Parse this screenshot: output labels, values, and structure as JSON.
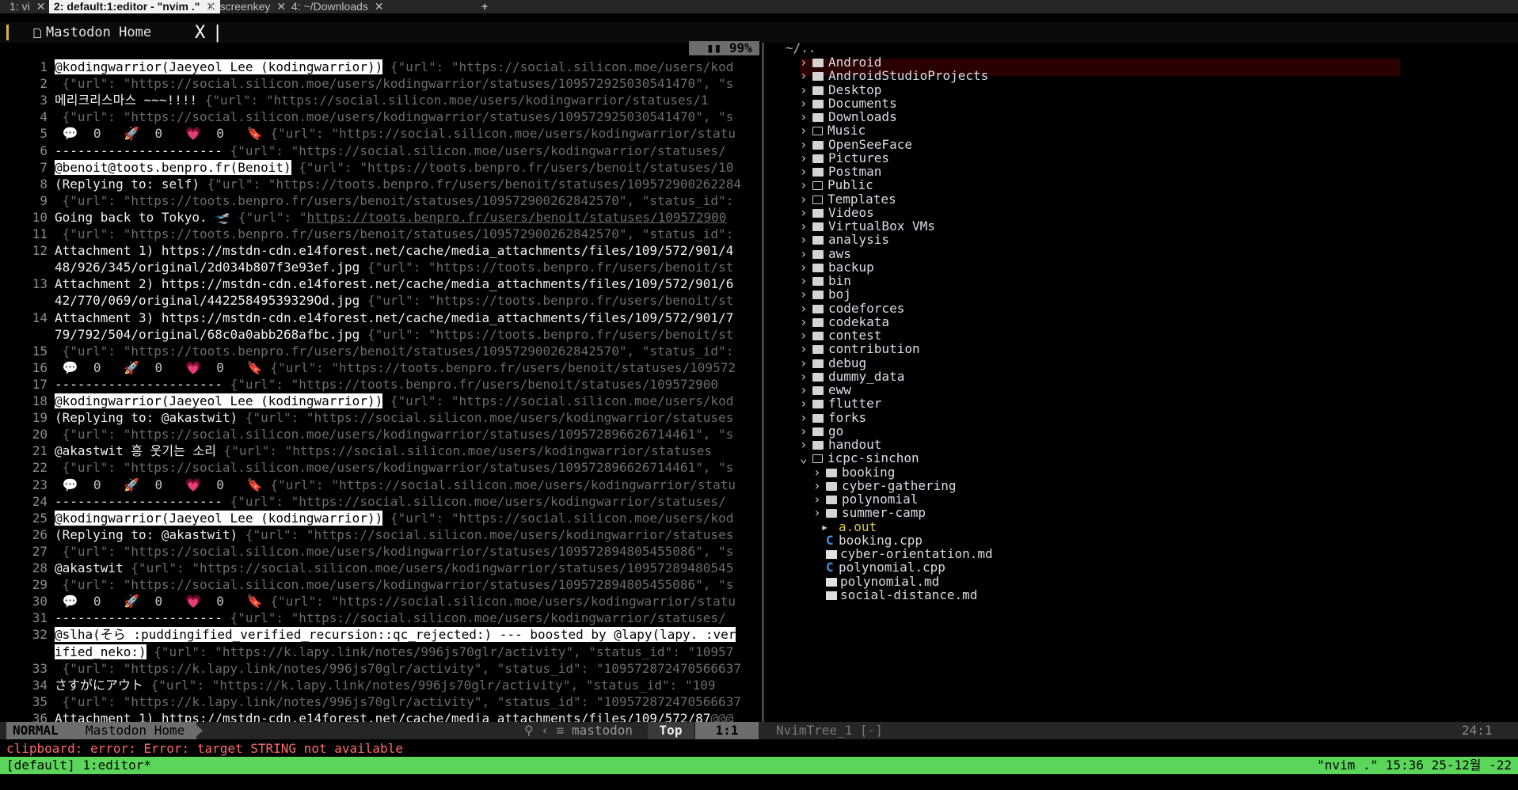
{
  "tabbar": {
    "tabs": [
      {
        "label": "1: vi",
        "close": "✕"
      },
      {
        "label": "2: default:1:editor - \"nvim .\"",
        "close": "✕"
      },
      {
        "label": "3: screenkey",
        "close": "✕"
      },
      {
        "label": "4: ~/Downloads",
        "close": "✕"
      }
    ],
    "new_tab": "+"
  },
  "bufferline": {
    "title": "Mastodon Home",
    "close": "X",
    "cursor": "|"
  },
  "winbar": {
    "battery": "99%"
  },
  "tree_header": "~/..",
  "editor_lines": [
    {
      "n": "1",
      "parts": [
        [
          "hl",
          "@kodingwarrior(Jaeyeol Lee (kodingwarrior))"
        ],
        [
          "json",
          " {\"url\": \"https://social.silicon.moe/users/kod"
        ]
      ]
    },
    {
      "n": "2",
      "parts": [
        [
          "json",
          " {\"url\": \"https://social.silicon.moe/users/kodingwarrior/statuses/109572925030541470\", \"s"
        ]
      ]
    },
    {
      "n": "3",
      "parts": [
        [
          "t",
          "메리크리스마스 ~~~!!!! "
        ],
        [
          "json",
          "{\"url\": \"https://social.silicon.moe/users/kodingwarrior/statuses/1"
        ]
      ]
    },
    {
      "n": "4",
      "parts": [
        [
          "json",
          " {\"url\": \"https://social.silicon.moe/users/kodingwarrior/statuses/109572925030541470\", \"s"
        ]
      ]
    },
    {
      "n": "5",
      "parts": [
        [
          "ic",
          " 💬  0   🚀  0   "
        ],
        [
          "pink",
          "💗"
        ],
        [
          "ic",
          "  0   🔖 "
        ],
        [
          "json",
          "{\"url\": \"https://social.silicon.moe/users/kodingwarrior/statu"
        ]
      ]
    },
    {
      "n": "6",
      "parts": [
        [
          "t",
          "---------------------- "
        ],
        [
          "json",
          "{\"url\": \"https://social.silicon.moe/users/kodingwarrior/statuses/"
        ]
      ]
    },
    {
      "n": "7",
      "parts": [
        [
          "hl",
          "@benoit@toots.benpro.fr(Benoit)"
        ],
        [
          "json",
          " {\"url\": \"https://toots.benpro.fr/users/benoit/statuses/10"
        ]
      ]
    },
    {
      "n": "8",
      "parts": [
        [
          "t",
          "(Replying to: self) "
        ],
        [
          "json",
          "{\"url\": \"https://toots.benpro.fr/users/benoit/statuses/109572900262284"
        ]
      ]
    },
    {
      "n": "9",
      "parts": [
        [
          "json",
          " {\"url\": \"https://toots.benpro.fr/users/benoit/statuses/109572900262842570\", \"status_id\":"
        ]
      ]
    },
    {
      "n": "10",
      "parts": [
        [
          "t",
          "Going back to Tokyo. 🛫 "
        ],
        [
          "json",
          "{\"url\": \""
        ],
        [
          "link",
          "https://toots.benpro.fr/users/benoit/statuses/109572900"
        ]
      ]
    },
    {
      "n": "11",
      "parts": [
        [
          "json",
          " {\"url\": \"https://toots.benpro.fr/users/benoit/statuses/109572900262842570\", \"status_id\":"
        ]
      ]
    },
    {
      "n": "12",
      "parts": [
        [
          "t",
          "Attachment 1) https://mstdn-cdn.e14forest.net/cache/media_attachments/files/109/572/901/4"
        ]
      ]
    },
    {
      "n": "",
      "parts": [
        [
          "t",
          "48/926/345/original/2d034b807f3e93ef.jpg "
        ],
        [
          "json",
          "{\"url\": \"https://toots.benpro.fr/users/benoit/st"
        ]
      ]
    },
    {
      "n": "13",
      "parts": [
        [
          "t",
          "Attachment 2) https://mstdn-cdn.e14forest.net/cache/media_attachments/files/109/572/901/6"
        ]
      ]
    },
    {
      "n": "",
      "parts": [
        [
          "t",
          "42/770/069/original/44225849539329Od.jpg "
        ],
        [
          "json",
          "{\"url\": \"https://toots.benpro.fr/users/benoit/st"
        ]
      ]
    },
    {
      "n": "14",
      "parts": [
        [
          "t",
          "Attachment 3) https://mstdn-cdn.e14forest.net/cache/media_attachments/files/109/572/901/7"
        ]
      ]
    },
    {
      "n": "",
      "parts": [
        [
          "t",
          "79/792/504/original/68c0a0abb268afbc.jpg "
        ],
        [
          "json",
          "{\"url\": \"https://toots.benpro.fr/users/benoit/st"
        ]
      ]
    },
    {
      "n": "15",
      "parts": [
        [
          "json",
          " {\"url\": \"https://toots.benpro.fr/users/benoit/statuses/109572900262842570\", \"status_id\":"
        ]
      ]
    },
    {
      "n": "16",
      "parts": [
        [
          "ic",
          " 💬  0   🚀  0   "
        ],
        [
          "pink",
          "💗"
        ],
        [
          "ic",
          "  0   🔖 "
        ],
        [
          "json",
          "{\"url\": \"https://toots.benpro.fr/users/benoit/statuses/109572"
        ]
      ]
    },
    {
      "n": "17",
      "parts": [
        [
          "t",
          "---------------------- "
        ],
        [
          "json",
          "{\"url\": \"https://toots.benpro.fr/users/benoit/statuses/109572900"
        ]
      ]
    },
    {
      "n": "18",
      "parts": [
        [
          "hl",
          "@kodingwarrior(Jaeyeol Lee (kodingwarrior))"
        ],
        [
          "json",
          " {\"url\": \"https://social.silicon.moe/users/kod"
        ]
      ]
    },
    {
      "n": "19",
      "parts": [
        [
          "t",
          "(Replying to: @akastwit) "
        ],
        [
          "json",
          "{\"url\": \"https://social.silicon.moe/users/kodingwarrior/statuses"
        ]
      ]
    },
    {
      "n": "20",
      "parts": [
        [
          "json",
          " {\"url\": \"https://social.silicon.moe/users/kodingwarrior/statuses/109572896626714461\", \"s"
        ]
      ]
    },
    {
      "n": "21",
      "parts": [
        [
          "t",
          "@akastwit 흥 웃기는 소리 "
        ],
        [
          "json",
          "{\"url\": \"https://social.silicon.moe/users/kodingwarrior/statuses"
        ]
      ]
    },
    {
      "n": "22",
      "parts": [
        [
          "json",
          " {\"url\": \"https://social.silicon.moe/users/kodingwarrior/statuses/109572896626714461\", \"s"
        ]
      ]
    },
    {
      "n": "23",
      "parts": [
        [
          "ic",
          " 💬  0   🚀  0   "
        ],
        [
          "pink",
          "💗"
        ],
        [
          "ic",
          "  0   🔖 "
        ],
        [
          "json",
          "{\"url\": \"https://social.silicon.moe/users/kodingwarrior/statu"
        ]
      ]
    },
    {
      "n": "24",
      "parts": [
        [
          "t",
          "---------------------- "
        ],
        [
          "json",
          "{\"url\": \"https://social.silicon.moe/users/kodingwarrior/statuses/"
        ]
      ]
    },
    {
      "n": "25",
      "parts": [
        [
          "hl",
          "@kodingwarrior(Jaeyeol Lee (kodingwarrior))"
        ],
        [
          "json",
          " {\"url\": \"https://social.silicon.moe/users/kod"
        ]
      ]
    },
    {
      "n": "26",
      "parts": [
        [
          "t",
          "(Replying to: @akastwit) "
        ],
        [
          "json",
          "{\"url\": \"https://social.silicon.moe/users/kodingwarrior/statuses"
        ]
      ]
    },
    {
      "n": "27",
      "parts": [
        [
          "json",
          " {\"url\": \"https://social.silicon.moe/users/kodingwarrior/statuses/109572894805455086\", \"s"
        ]
      ]
    },
    {
      "n": "28",
      "parts": [
        [
          "t",
          "@akastwit "
        ],
        [
          "json",
          "{\"url\": \"https://social.silicon.moe/users/kodingwarrior/statuses/10957289480545"
        ]
      ]
    },
    {
      "n": "29",
      "parts": [
        [
          "json",
          " {\"url\": \"https://social.silicon.moe/users/kodingwarrior/statuses/109572894805455086\", \"s"
        ]
      ]
    },
    {
      "n": "30",
      "parts": [
        [
          "ic",
          " 💬  0   🚀  0   "
        ],
        [
          "pink",
          "💗"
        ],
        [
          "ic",
          "  0   🔖 "
        ],
        [
          "json",
          "{\"url\": \"https://social.silicon.moe/users/kodingwarrior/statu"
        ]
      ]
    },
    {
      "n": "31",
      "parts": [
        [
          "t",
          "---------------------- "
        ],
        [
          "json",
          "{\"url\": \"https://social.silicon.moe/users/kodingwarrior/statuses/"
        ]
      ]
    },
    {
      "n": "32",
      "parts": [
        [
          "hl",
          "@slha(そら :puddingified_verified_recursion::qc_rejected:) --- boosted by @lapy(lapy. :ver"
        ]
      ]
    },
    {
      "n": "",
      "parts": [
        [
          "hl",
          "ified_neko:)"
        ],
        [
          "json",
          " {\"url\": \"https://k.lapy.link/notes/996js70glr/activity\", \"status_id\": \"10957"
        ]
      ]
    },
    {
      "n": "33",
      "parts": [
        [
          "json",
          " {\"url\": \"https://k.lapy.link/notes/996js70glr/activity\", \"status_id\": \"109572872470566637"
        ]
      ]
    },
    {
      "n": "34",
      "parts": [
        [
          "t",
          "さすがにアウト "
        ],
        [
          "json",
          "{\"url\": \"https://k.lapy.link/notes/996js70glr/activity\", \"status_id\": \"109"
        ]
      ]
    },
    {
      "n": "35",
      "parts": [
        [
          "json",
          " {\"url\": \"https://k.lapy.link/notes/996js70glr/activity\", \"status_id\": \"109572872470566637"
        ]
      ]
    },
    {
      "n": "36",
      "parts": [
        [
          "t",
          "Attachment 1) https://mstdn-cdn.e14forest.net/cache/media_attachments/files/109/572/87"
        ],
        [
          "json",
          "@@@"
        ]
      ]
    }
  ],
  "tree_items": [
    {
      "name": "Android",
      "kind": "dir",
      "depth": 0
    },
    {
      "name": "AndroidStudioProjects",
      "kind": "dir",
      "depth": 0
    },
    {
      "name": "Desktop",
      "kind": "dir",
      "depth": 0
    },
    {
      "name": "Documents",
      "kind": "dir",
      "depth": 0
    },
    {
      "name": "Downloads",
      "kind": "dir",
      "depth": 0
    },
    {
      "name": "Music",
      "kind": "dir-empty",
      "depth": 0
    },
    {
      "name": "OpenSeeFace",
      "kind": "dir",
      "depth": 0
    },
    {
      "name": "Pictures",
      "kind": "dir",
      "depth": 0
    },
    {
      "name": "Postman",
      "kind": "dir",
      "depth": 0
    },
    {
      "name": "Public",
      "kind": "dir-empty",
      "depth": 0
    },
    {
      "name": "Templates",
      "kind": "dir-empty",
      "depth": 0
    },
    {
      "name": "Videos",
      "kind": "dir",
      "depth": 0
    },
    {
      "name": "VirtualBox VMs",
      "kind": "dir",
      "depth": 0
    },
    {
      "name": "analysis",
      "kind": "dir",
      "depth": 0
    },
    {
      "name": "aws",
      "kind": "dir",
      "depth": 0
    },
    {
      "name": "backup",
      "kind": "dir",
      "depth": 0
    },
    {
      "name": "bin",
      "kind": "dir",
      "depth": 0
    },
    {
      "name": "boj",
      "kind": "dir",
      "depth": 0
    },
    {
      "name": "codeforces",
      "kind": "dir",
      "depth": 0
    },
    {
      "name": "codekata",
      "kind": "dir",
      "depth": 0
    },
    {
      "name": "contest",
      "kind": "dir",
      "depth": 0
    },
    {
      "name": "contribution",
      "kind": "dir",
      "depth": 0
    },
    {
      "name": "debug",
      "kind": "dir",
      "depth": 0
    },
    {
      "name": "dummy_data",
      "kind": "dir",
      "depth": 0
    },
    {
      "name": "eww",
      "kind": "dir",
      "depth": 0
    },
    {
      "name": "flutter",
      "kind": "dir",
      "depth": 0
    },
    {
      "name": "forks",
      "kind": "dir",
      "depth": 0
    },
    {
      "name": "go",
      "kind": "dir",
      "depth": 0
    },
    {
      "name": "handout",
      "kind": "dir",
      "depth": 0
    },
    {
      "name": "icpc-sinchon",
      "kind": "dir-open",
      "depth": 0
    },
    {
      "name": "booking",
      "kind": "dir",
      "depth": 1
    },
    {
      "name": "cyber-gathering",
      "kind": "dir",
      "depth": 1
    },
    {
      "name": "polynomial",
      "kind": "dir",
      "depth": 1
    },
    {
      "name": "summer-camp",
      "kind": "dir",
      "depth": 1
    },
    {
      "name": "a.out",
      "kind": "exe",
      "depth": 1
    },
    {
      "name": "booking.cpp",
      "kind": "cpp",
      "depth": 1
    },
    {
      "name": "cyber-orientation.md",
      "kind": "md",
      "depth": 1
    },
    {
      "name": "polynomial.cpp",
      "kind": "cpp",
      "depth": 1
    },
    {
      "name": "polynomial.md",
      "kind": "md",
      "depth": 1
    },
    {
      "name": "social-distance.md",
      "kind": "md",
      "depth": 1
    }
  ],
  "statusline": {
    "mode": "NORMAL",
    "file": "Mastodon Home",
    "branch": "mastodon",
    "position": "Top",
    "cursor": "1:1",
    "tree_name": "NvimTree_1 [-]",
    "tree_pos": "24:1"
  },
  "message": "clipboard: error: Error: target STRING not available",
  "tmux": {
    "left": "[default] 1:editor*",
    "right": "\"nvim .\" 15:36 25-12월 -22"
  },
  "colors": {
    "tmux_bg": "#5bd65b",
    "mode_bg": "#6d6d6d",
    "accent_yellow": "#d9b441",
    "error_red": "#ff6b6b"
  }
}
